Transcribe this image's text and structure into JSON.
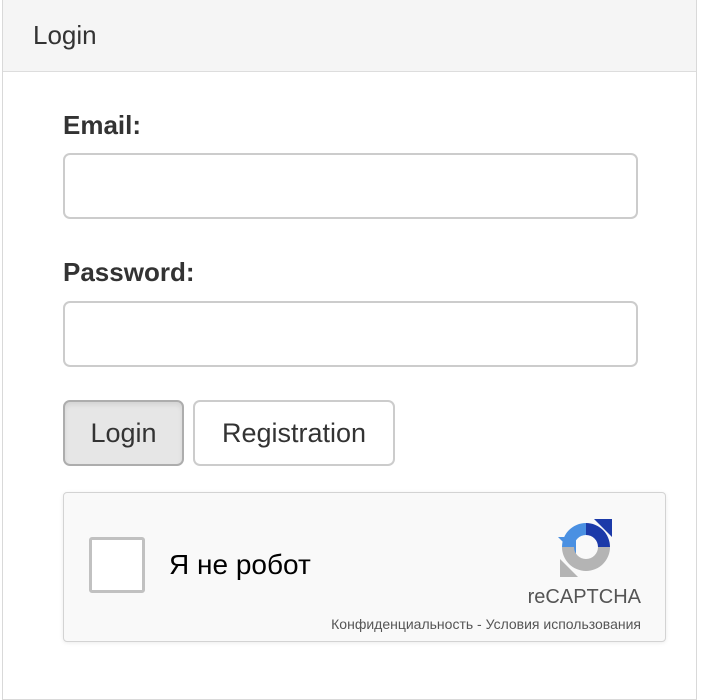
{
  "panel": {
    "title": "Login"
  },
  "form": {
    "email_label": "Email:",
    "email_value": "",
    "password_label": "Password:",
    "password_value": "",
    "login_button": "Login",
    "registration_button": "Registration"
  },
  "recaptcha": {
    "checkbox_label": "Я не робот",
    "brand": "reCAPTCHA",
    "privacy_link": "Конфиденциальность",
    "separator": " - ",
    "terms_link": "Условия использования",
    "logo_icon": "recaptcha-logo-icon",
    "colors": {
      "blue": "#1c3aa9",
      "light_blue": "#4a90e2",
      "gray": "#b4b4b4"
    }
  }
}
